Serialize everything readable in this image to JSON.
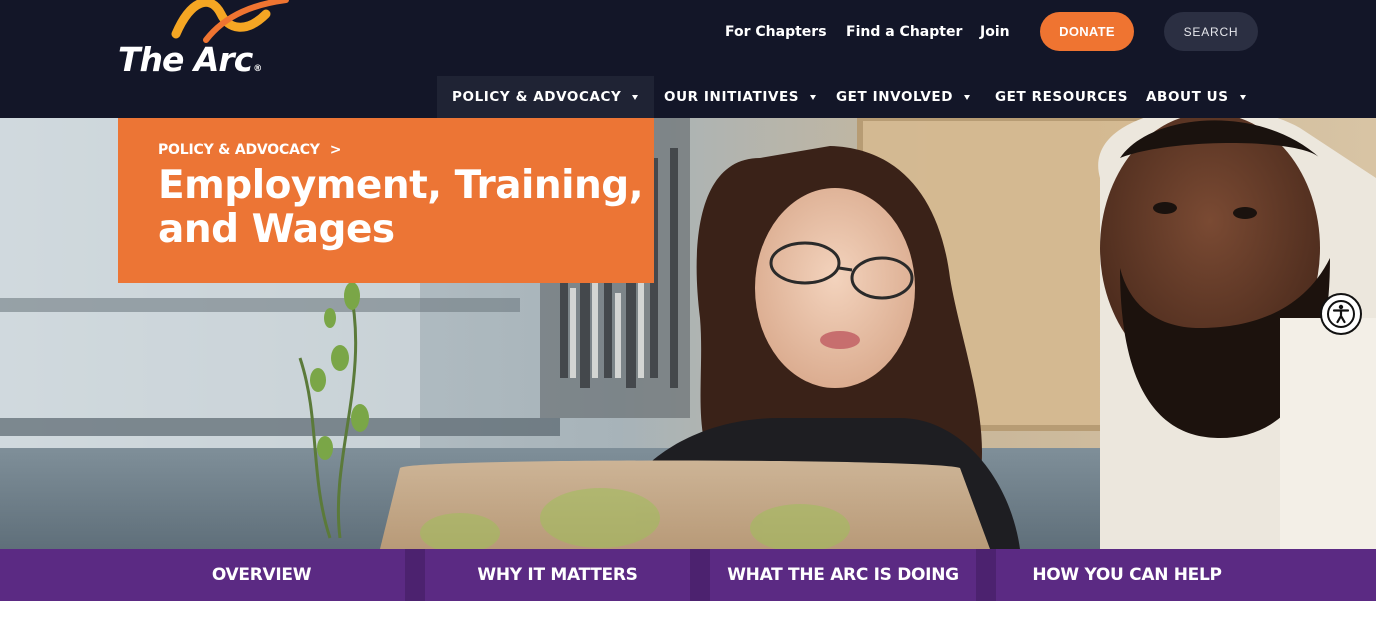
{
  "brand": {
    "logo_text": "The Arc",
    "logo_mark": "®",
    "colors": {
      "header_bg": "#131628",
      "accent_orange": "#ec7535",
      "tabs_purple": "#5b2a83"
    }
  },
  "utility_nav": {
    "links": [
      "For Chapters",
      "Find a Chapter",
      "Join"
    ],
    "donate_label": "DONATE",
    "search_label": "SEARCH"
  },
  "main_nav": {
    "items": [
      {
        "label": "POLICY & ADVOCACY",
        "has_dropdown": true,
        "active": true
      },
      {
        "label": "OUR INITIATIVES",
        "has_dropdown": true,
        "active": false
      },
      {
        "label": "GET INVOLVED",
        "has_dropdown": true,
        "active": false
      },
      {
        "label": "GET RESOURCES",
        "has_dropdown": false,
        "active": false
      },
      {
        "label": "ABOUT US",
        "has_dropdown": true,
        "active": false
      }
    ]
  },
  "hero": {
    "breadcrumb": "POLICY & ADVOCACY",
    "breadcrumb_separator": ">",
    "title_line1": "Employment, Training,",
    "title_line2": "and Wages"
  },
  "accessibility": {
    "icon": "accessibility-icon"
  },
  "section_tabs": [
    "OVERVIEW",
    "WHY IT MATTERS",
    "WHAT THE ARC IS DOING",
    "HOW YOU CAN HELP"
  ]
}
